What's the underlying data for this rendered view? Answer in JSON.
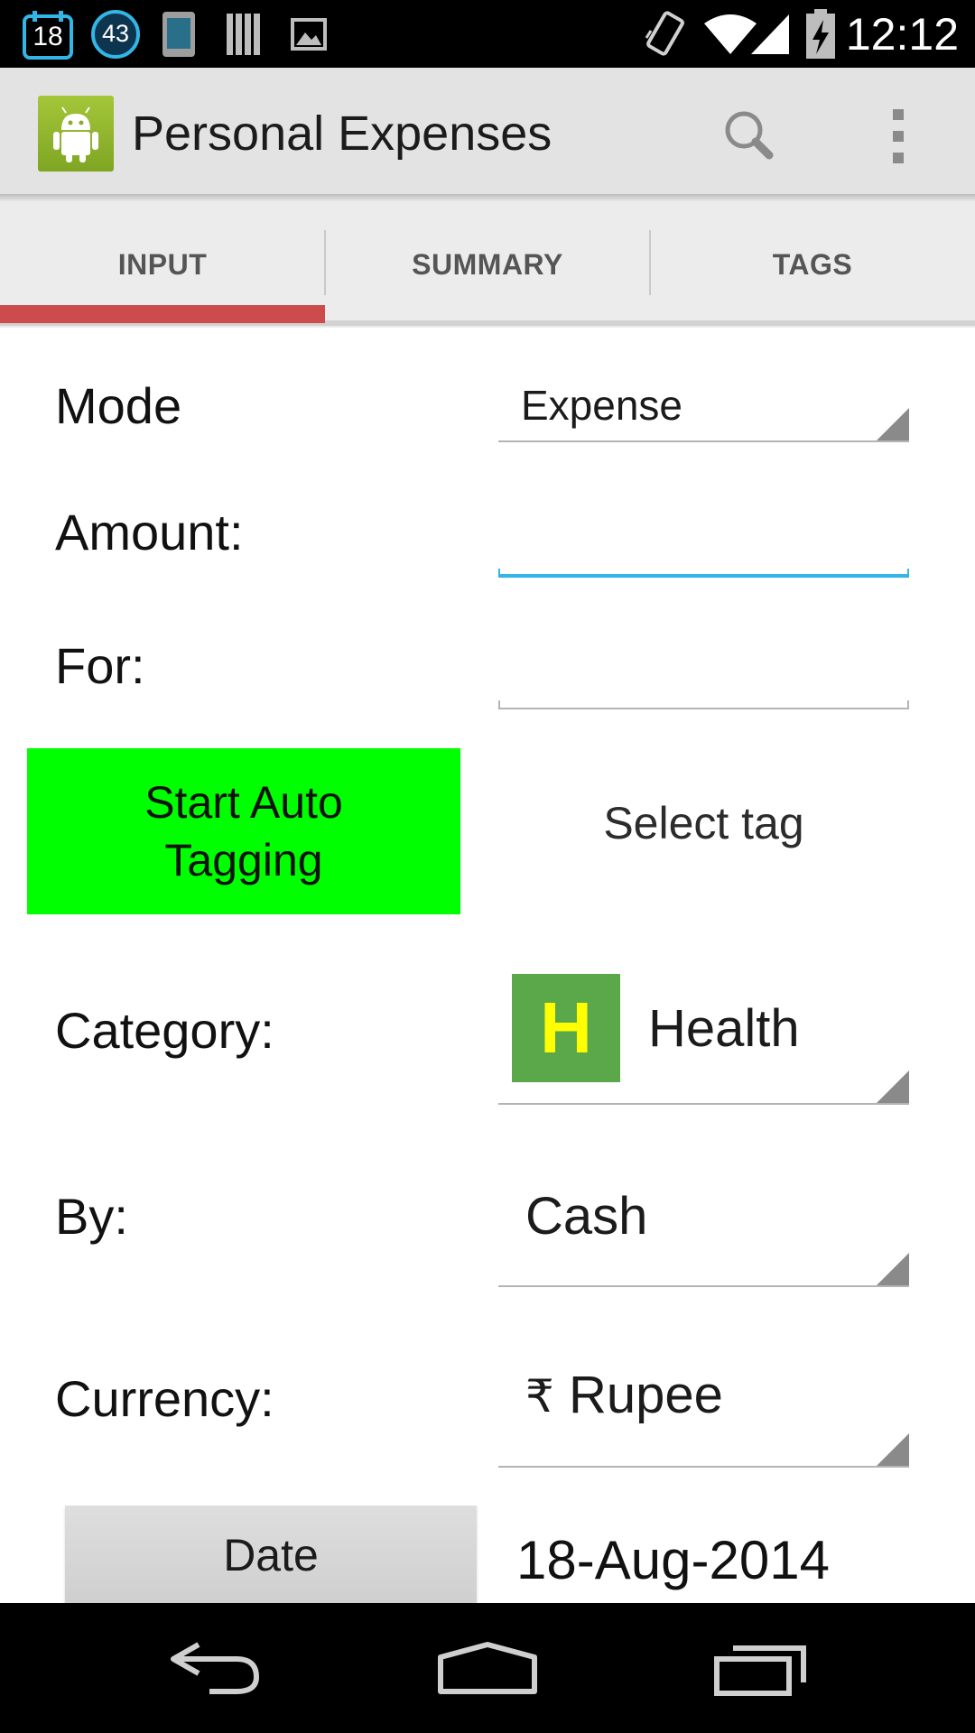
{
  "status_bar": {
    "calendar_badge": "18",
    "notification_count": "43",
    "time": "12:12"
  },
  "action_bar": {
    "title": "Personal Expenses",
    "icons": [
      "android-app-icon",
      "search-icon",
      "overflow-menu-icon"
    ]
  },
  "tabs": [
    {
      "label": "INPUT",
      "selected": true
    },
    {
      "label": "SUMMARY",
      "selected": false
    },
    {
      "label": "TAGS",
      "selected": false
    }
  ],
  "form": {
    "mode": {
      "label": "Mode",
      "value": "Expense"
    },
    "amount": {
      "label": "Amount:",
      "value": "",
      "focused": true
    },
    "for": {
      "label": "For:",
      "value": ""
    },
    "auto_tagging_button": "Start Auto Tagging",
    "select_tag": "Select tag",
    "category": {
      "label": "Category:",
      "icon_letter": "H",
      "value": "Health"
    },
    "by": {
      "label": "By:",
      "value": "Cash"
    },
    "currency": {
      "label": "Currency:",
      "symbol": "₹",
      "value": "Rupee"
    },
    "date": {
      "button_label": "Date",
      "value": "18-Aug-2014"
    }
  },
  "colors": {
    "tab_indicator": "#cc4b4b",
    "focus_accent": "#33b5e5",
    "auto_tag_button": "#00ff00",
    "category_badge": "#5aa84a",
    "category_letter": "#ffff00"
  }
}
